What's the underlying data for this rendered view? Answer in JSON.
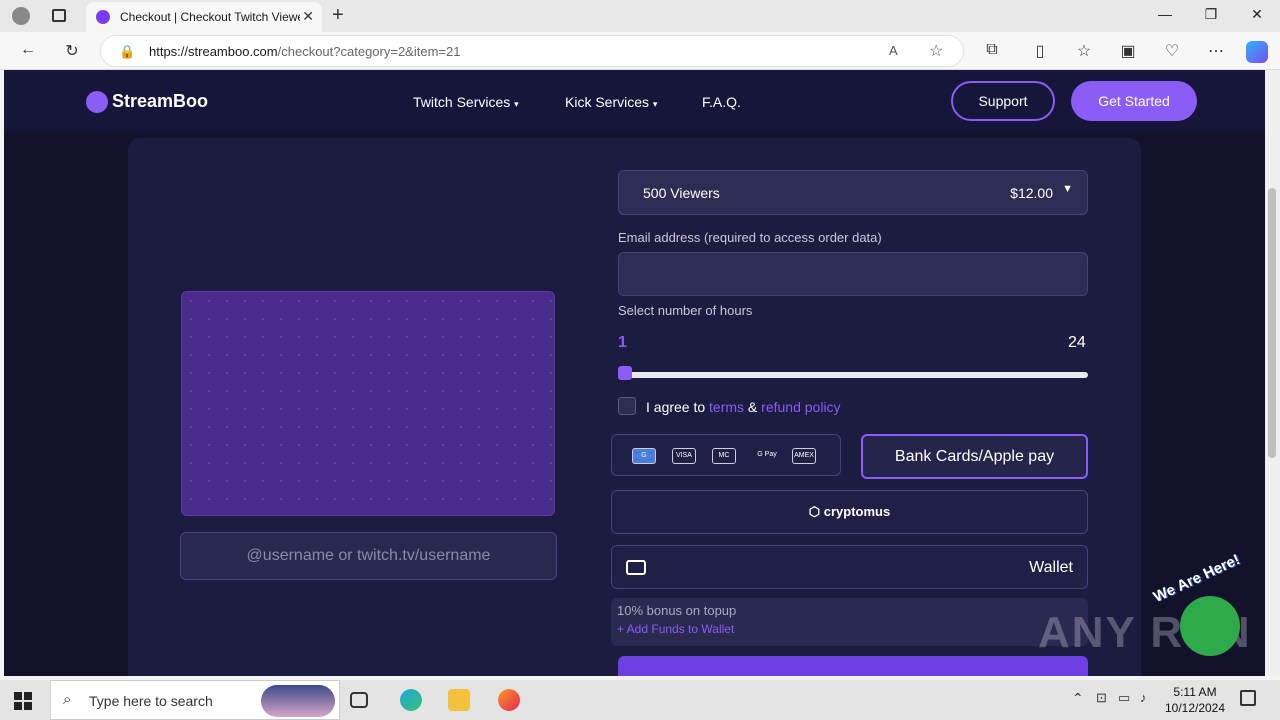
{
  "browser": {
    "tab_title": "Checkout | Checkout Twitch Viewers",
    "url_domain": "https://streamboo.com",
    "url_path": "/checkout?category=2&item=21"
  },
  "header": {
    "logo": "StreamBoo",
    "nav": [
      "Twitch Services",
      "Kick Services",
      "F.A.Q."
    ],
    "support": "Support",
    "get_started": "Get Started"
  },
  "checkout": {
    "package": "500 Viewers",
    "price": "$12.00",
    "email_label": "Email address (required to access order data)",
    "hours_label": "Select number of hours",
    "hours_min": "1",
    "hours_max": "24",
    "agree_prefix": "I agree to ",
    "terms": "terms",
    "and": " & ",
    "refund": "refund policy",
    "username_placeholder": "@username or twitch.tv/username",
    "pay_cards": "Bank Cards/Apple pay",
    "crypto": "cryptomus",
    "wallet": "Wallet",
    "bonus": "10% bonus on topup",
    "add_funds": "+ Add Funds to Wallet",
    "pay_icon_labels": [
      "G",
      "VISA",
      "MC",
      "G Pay",
      "AMEX"
    ]
  },
  "taskbar": {
    "search": "Type here to search",
    "time": "5:11 AM",
    "date": "10/12/2024"
  },
  "overlay": {
    "watermark": "ANY RUN",
    "badge": "We Are Here!"
  }
}
